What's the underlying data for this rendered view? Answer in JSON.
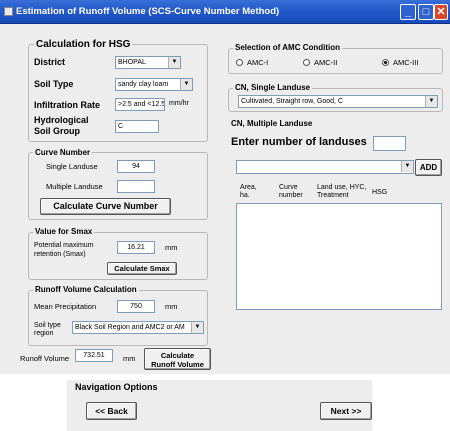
{
  "window": {
    "title": "Estimation of Runoff Volume (SCS-Curve Number Method)"
  },
  "hsg": {
    "heading": "Calculation for HSG",
    "district_label": "District",
    "district_value": "BHOPAL",
    "soil_type_label": "Soil Type",
    "soil_type_value": "sandy clay loam",
    "infiltration_label": "Infiltration Rate",
    "infiltration_value": ">2.5 and <12.5",
    "infiltration_unit": "mm/hr",
    "hsg_label_1": "Hydrological",
    "hsg_label_2": "Soil Group",
    "hsg_value": "C"
  },
  "curve_number": {
    "heading": "Curve Number",
    "single_label": "Single Landuse",
    "single_value": "94",
    "multiple_label": "Multiple Landuse",
    "multiple_value": "",
    "calc_button": "Calculate Curve Number"
  },
  "smax": {
    "heading": "Value for Smax",
    "label_1": "Potential maximum",
    "label_2": "retention (Smax)",
    "value": "16.21",
    "unit": "mm",
    "calc_button": "Calculate Smax"
  },
  "runoff_calc": {
    "heading": "Runoff Volume Calculation",
    "precip_label": "Mean Precipitation",
    "precip_value": "750",
    "precip_unit": "mm",
    "soil_region_label_1": "Soil type",
    "soil_region_label_2": "region",
    "soil_region_value": "Black Soil Region and AMC2 or AM"
  },
  "runoff_result": {
    "label": "Runoff Volume",
    "value": "732.51",
    "unit": "mm",
    "calc_button_1": "Calculate",
    "calc_button_2": "Runoff Volume"
  },
  "amc": {
    "heading": "Selection of AMC Condition",
    "options": [
      "AMC-I",
      "AMC-II",
      "AMC-III"
    ],
    "selected": "AMC-III"
  },
  "single_landuse": {
    "heading": "CN, Single Landuse",
    "value": "Cultivated, Straight row, Good, C"
  },
  "multi_landuse": {
    "heading": "CN, Multiple Landuse",
    "enter_label": "Enter number of landuses",
    "count_value": "",
    "add_button": "ADD",
    "columns": [
      "Area,\nha.",
      "Curve\nnumber",
      "Land use, HYC,\nTreatment",
      "HSG"
    ]
  },
  "navigation": {
    "heading": "Navigation Options",
    "back_button": "<< Back",
    "next_button": "Next >>"
  }
}
